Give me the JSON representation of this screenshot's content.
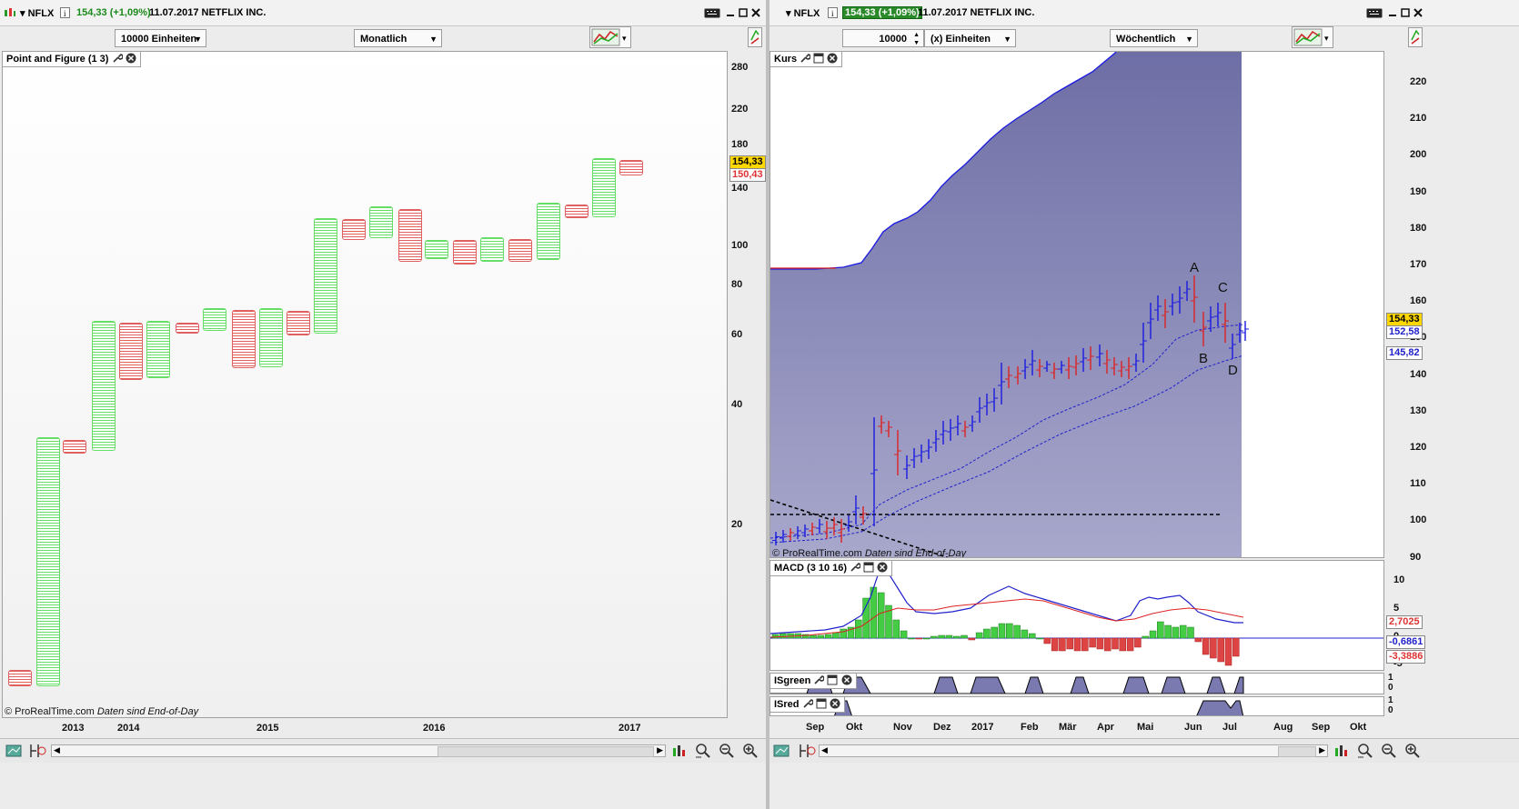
{
  "left": {
    "symbol": "NFLX",
    "price_change": "154,33 (+1,09%)",
    "date_name": "11.07.2017 NETFLIX INC.",
    "units_select": "10000 Einheiten",
    "period_select": "Monatlich",
    "chart_title": "Point and Figure (1 3)",
    "price_tag_current": "154,33",
    "price_tag_prev": "150,43",
    "y_ticks": [
      "280",
      "220",
      "180",
      "140",
      "100",
      "80",
      "60",
      "40",
      "20"
    ],
    "x_ticks": [
      "2013",
      "2014",
      "2015",
      "2016",
      "2017"
    ],
    "footer_brand": "© ProRealTime.com",
    "footer_note": "Daten sind End-of-Day"
  },
  "right": {
    "symbol": "NFLX",
    "price_change": "154,33 (+1,09%)",
    "date_name": "11.07.2017 NETFLIX INC.",
    "units_value": "10000",
    "units_label": "(x) Einheiten",
    "period_select": "Wöchentlich",
    "price_title": "Kurs",
    "price_tag_current": "154,33",
    "price_tag_ma1": "152,58",
    "price_tag_ma2": "145,82",
    "y_ticks": [
      "220",
      "210",
      "200",
      "190",
      "180",
      "170",
      "160",
      "150",
      "140",
      "130",
      "120",
      "110",
      "100",
      "90"
    ],
    "wave_labels": [
      "A",
      "B",
      "C",
      "D"
    ],
    "footer_brand": "© ProRealTime.com",
    "footer_note": "Daten sind End-of-Day",
    "macd_title": "MACD (3 10 16)",
    "macd_ticks": [
      "10",
      "5",
      "0",
      "-5"
    ],
    "macd_tag_signal": "2,7025",
    "macd_tag_value": "-0,6861",
    "macd_tag_hist": "-3,3886",
    "isgreen_title": "ISgreen",
    "isred_title": "ISred",
    "is_ticks_top": [
      "1",
      "0"
    ],
    "is_ticks_bottom": [
      "1",
      "0"
    ],
    "x_ticks": [
      "Sep",
      "Okt",
      "Nov",
      "Dez",
      "2017",
      "Feb",
      "Mär",
      "Apr",
      "Mai",
      "Jun",
      "Jul",
      "Aug",
      "Sep",
      "Okt"
    ]
  },
  "colors": {
    "x_green": "#66dd66",
    "o_red": "#e06060",
    "area_fill": "#7a7ab0",
    "macd_green": "#44cc44",
    "macd_red": "#dd4444",
    "price_tag_bg": "#ffd700"
  },
  "icons": [
    "chart-type-icon",
    "info-icon",
    "keyboard-icon",
    "minimize-icon",
    "maximize-icon",
    "close-icon",
    "wrench-icon",
    "window-icon",
    "zoom-in-icon",
    "zoom-out-icon",
    "zoom-fit-icon",
    "scroll-left-icon",
    "scroll-right-icon",
    "drawing-tools-icon"
  ]
}
